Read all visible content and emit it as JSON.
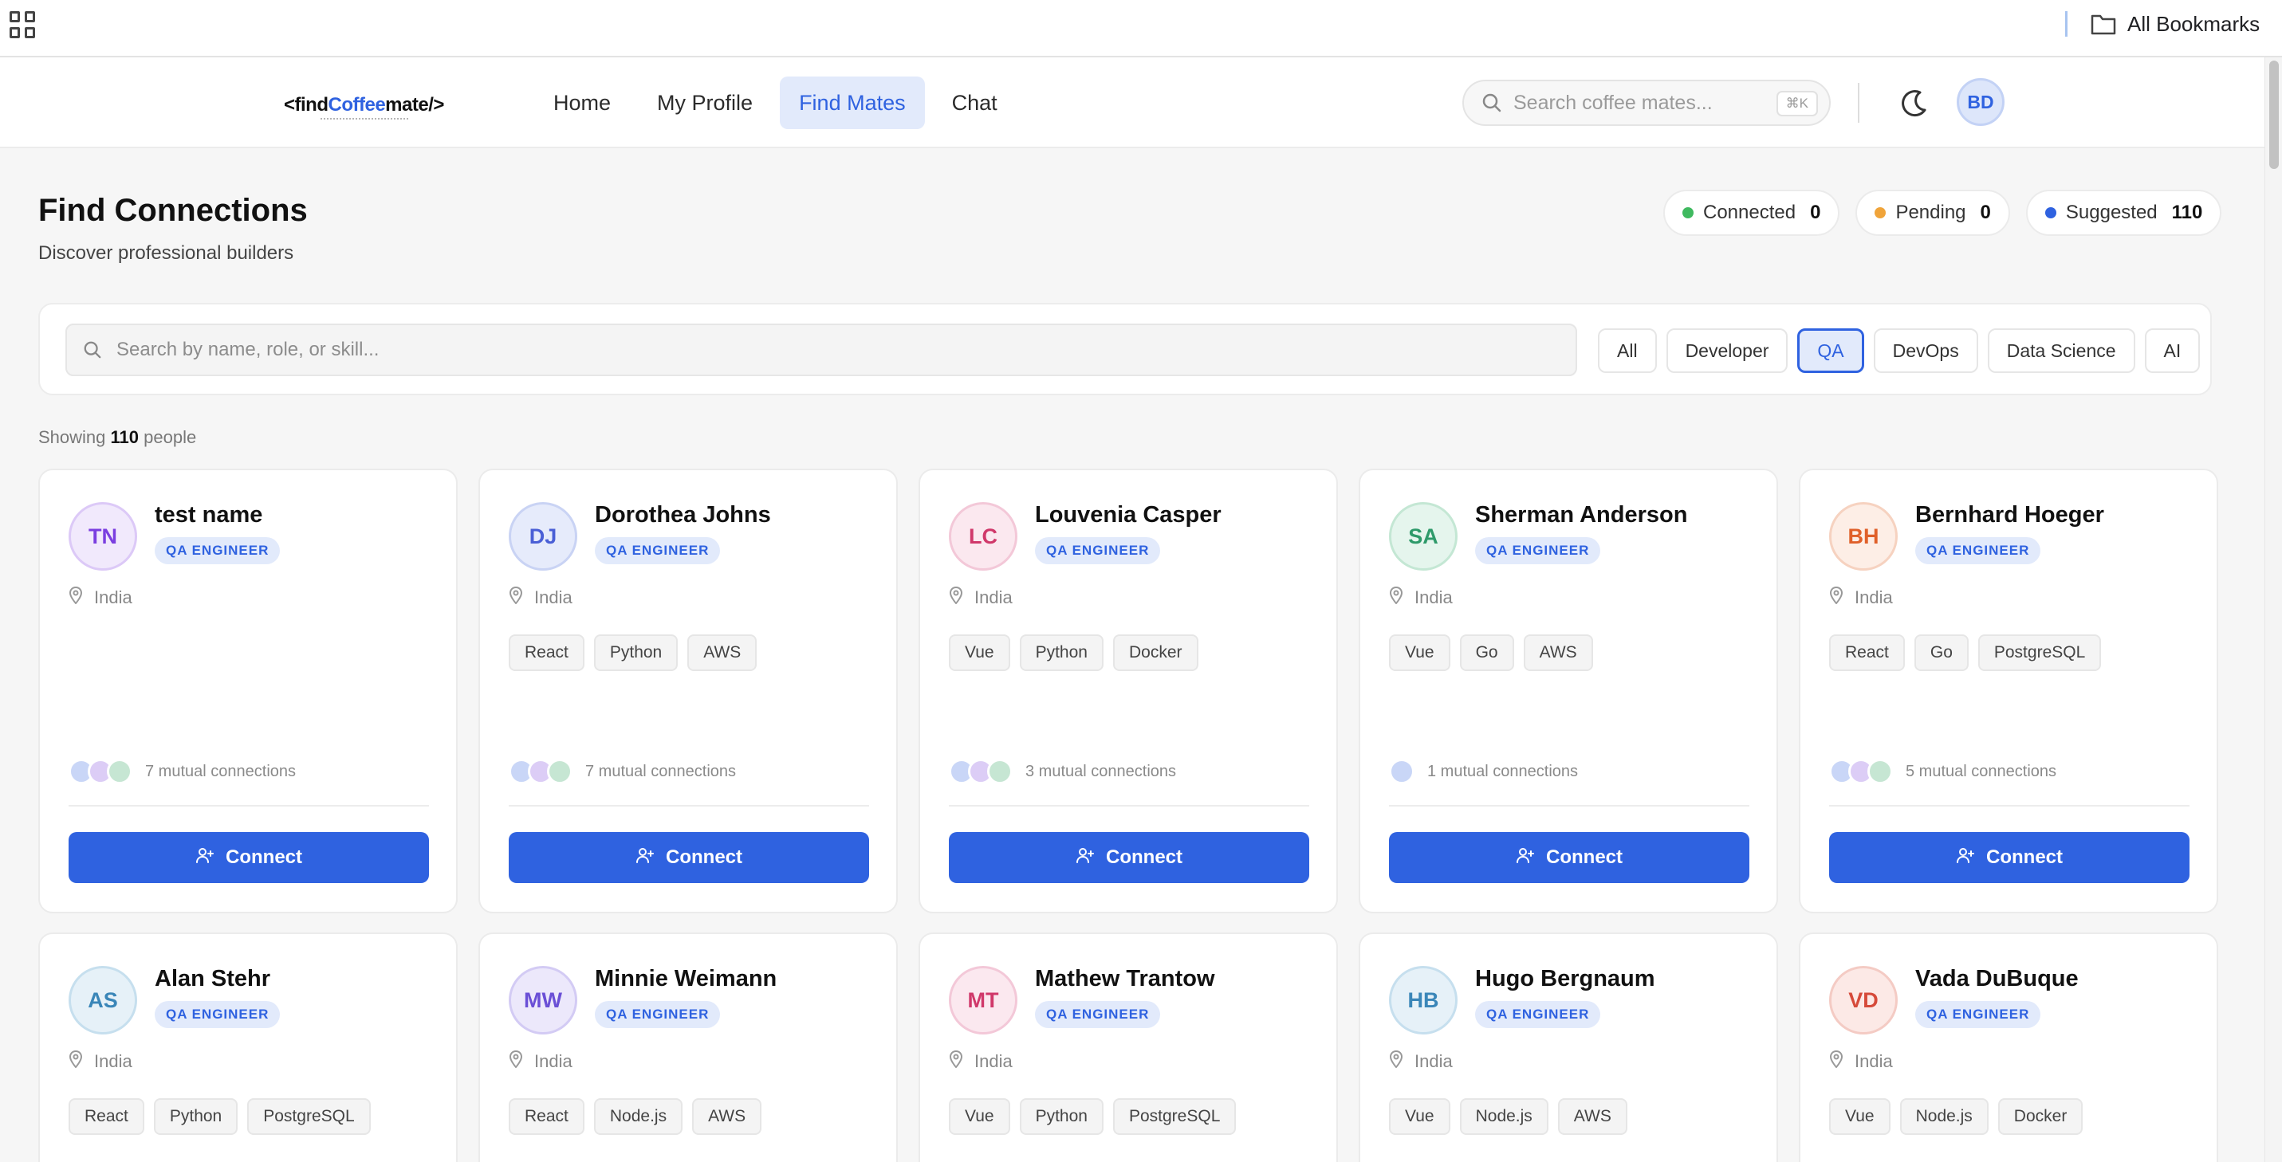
{
  "browser": {
    "bookmarks_label": "All Bookmarks"
  },
  "header": {
    "logo": {
      "prefix": "<find",
      "accent": "Coffee",
      "suffix": "mate/>"
    },
    "nav": [
      {
        "label": "Home",
        "active": false
      },
      {
        "label": "My Profile",
        "active": false
      },
      {
        "label": "Find Mates",
        "active": true
      },
      {
        "label": "Chat",
        "active": false
      }
    ],
    "search": {
      "placeholder": "Search coffee mates...",
      "shortcut": "⌘K"
    },
    "avatar": "BD"
  },
  "page": {
    "title": "Find Connections",
    "subtitle": "Discover professional builders"
  },
  "stats": [
    {
      "label": "Connected",
      "value": "0",
      "color": "#3fb95f"
    },
    {
      "label": "Pending",
      "value": "0",
      "color": "#f0a43a"
    },
    {
      "label": "Suggested",
      "value": "110",
      "color": "#2f62e0"
    }
  ],
  "filters": {
    "search_placeholder": "Search by name, role, or skill...",
    "chips": [
      {
        "label": "All",
        "active": false
      },
      {
        "label": "Developer",
        "active": false
      },
      {
        "label": "QA",
        "active": true
      },
      {
        "label": "DevOps",
        "active": false
      },
      {
        "label": "Data Science",
        "active": false
      },
      {
        "label": "AI",
        "active": false
      }
    ]
  },
  "results": {
    "prefix": "Showing",
    "count": "110",
    "suffix": "people"
  },
  "people": [
    {
      "initials": "TN",
      "name": "test name",
      "role": "QA ENGINEER",
      "location": "India",
      "skills": [],
      "mutual_count": 3,
      "mutual": "7 mutual connections",
      "fg": "#7b3fe0",
      "bg": "#f1e9fc",
      "border": "#dcc9f7",
      "action": "Connect"
    },
    {
      "initials": "DJ",
      "name": "Dorothea Johns",
      "role": "QA ENGINEER",
      "location": "India",
      "skills": [
        "React",
        "Python",
        "AWS"
      ],
      "mutual_count": 3,
      "mutual": "7 mutual connections",
      "fg": "#4a5fd6",
      "bg": "#e6ebfb",
      "border": "#c9d3f4",
      "action": "Connect"
    },
    {
      "initials": "LC",
      "name": "Louvenia Casper",
      "role": "QA ENGINEER",
      "location": "India",
      "skills": [
        "Vue",
        "Python",
        "Docker"
      ],
      "mutual_count": 3,
      "mutual": "3 mutual connections",
      "fg": "#d0386a",
      "bg": "#fbe8ef",
      "border": "#f3c8d8",
      "action": "Connect"
    },
    {
      "initials": "SA",
      "name": "Sherman Anderson",
      "role": "QA ENGINEER",
      "location": "India",
      "skills": [
        "Vue",
        "Go",
        "AWS"
      ],
      "mutual_count": 1,
      "mutual": "1 mutual connections",
      "fg": "#2e9a6a",
      "bg": "#e5f5ed",
      "border": "#c4e7d4",
      "action": "Connect"
    },
    {
      "initials": "BH",
      "name": "Bernhard Hoeger",
      "role": "QA ENGINEER",
      "location": "India",
      "skills": [
        "React",
        "Go",
        "PostgreSQL"
      ],
      "mutual_count": 3,
      "mutual": "5 mutual connections",
      "fg": "#e0602a",
      "bg": "#fdeee6",
      "border": "#f6d2c0",
      "action": "Connect"
    },
    {
      "initials": "AS",
      "name": "Alan Stehr",
      "role": "QA ENGINEER",
      "location": "India",
      "skills": [
        "React",
        "Python",
        "PostgreSQL"
      ],
      "fg": "#3a86b8",
      "bg": "#e6f1f8",
      "border": "#c6dfee"
    },
    {
      "initials": "MW",
      "name": "Minnie Weimann",
      "role": "QA ENGINEER",
      "location": "India",
      "skills": [
        "React",
        "Node.js",
        "AWS"
      ],
      "fg": "#6a4fd6",
      "bg": "#ece8fb",
      "border": "#d3cbf4"
    },
    {
      "initials": "MT",
      "name": "Mathew Trantow",
      "role": "QA ENGINEER",
      "location": "India",
      "skills": [
        "Vue",
        "Python",
        "PostgreSQL"
      ],
      "fg": "#d0386a",
      "bg": "#fbe8ef",
      "border": "#f3c8d8"
    },
    {
      "initials": "HB",
      "name": "Hugo Bergnaum",
      "role": "QA ENGINEER",
      "location": "India",
      "skills": [
        "Vue",
        "Node.js",
        "AWS"
      ],
      "fg": "#3a86b8",
      "bg": "#e6f1f8",
      "border": "#c6dfee"
    },
    {
      "initials": "VD",
      "name": "Vada DuBuque",
      "role": "QA ENGINEER",
      "location": "India",
      "skills": [
        "Vue",
        "Node.js",
        "Docker"
      ],
      "fg": "#d64a3a",
      "bg": "#fce9e6",
      "border": "#f4cbc4"
    }
  ]
}
